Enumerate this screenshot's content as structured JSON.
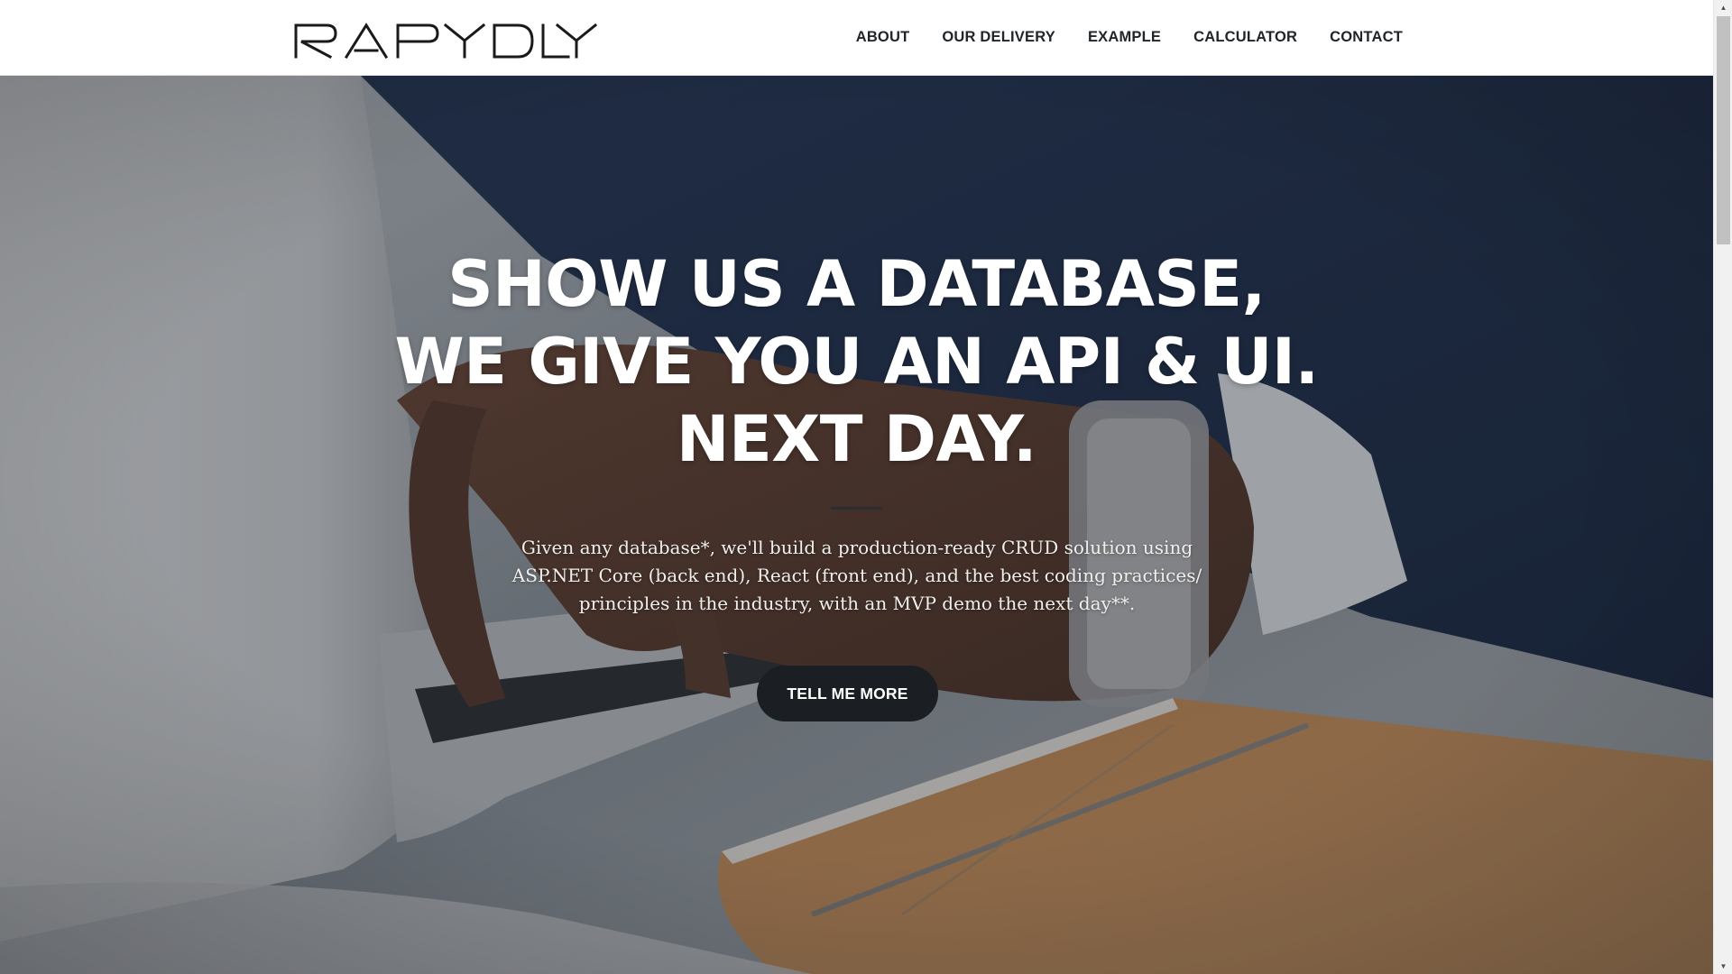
{
  "brand": {
    "logo_text": "RAPYDLY"
  },
  "nav": {
    "items": [
      {
        "label": "ABOUT"
      },
      {
        "label": "OUR DELIVERY"
      },
      {
        "label": "EXAMPLE"
      },
      {
        "label": "CALCULATOR"
      },
      {
        "label": "CONTACT"
      }
    ]
  },
  "hero": {
    "headline_lines": [
      "SHOW US A DATABASE,",
      "WE GIVE YOU AN API & UI.",
      "NEXT DAY."
    ],
    "description": "Given any database*, we'll build a production-ready CRUD solution using ASP.NET Core (back end), React (front end), and the best coding practices/ principles in the industry, with an MVP demo the next day**.",
    "cta_label": "TELL ME MORE"
  },
  "colors": {
    "nav_text": "#212529",
    "hero_text": "#ffffff",
    "cta_background": "#1b1f24",
    "divider": "#2a2e33"
  },
  "icons": {
    "scroll_up": "scroll-up-arrow-icon",
    "scroll_down": "scroll-down-arrow-icon"
  }
}
